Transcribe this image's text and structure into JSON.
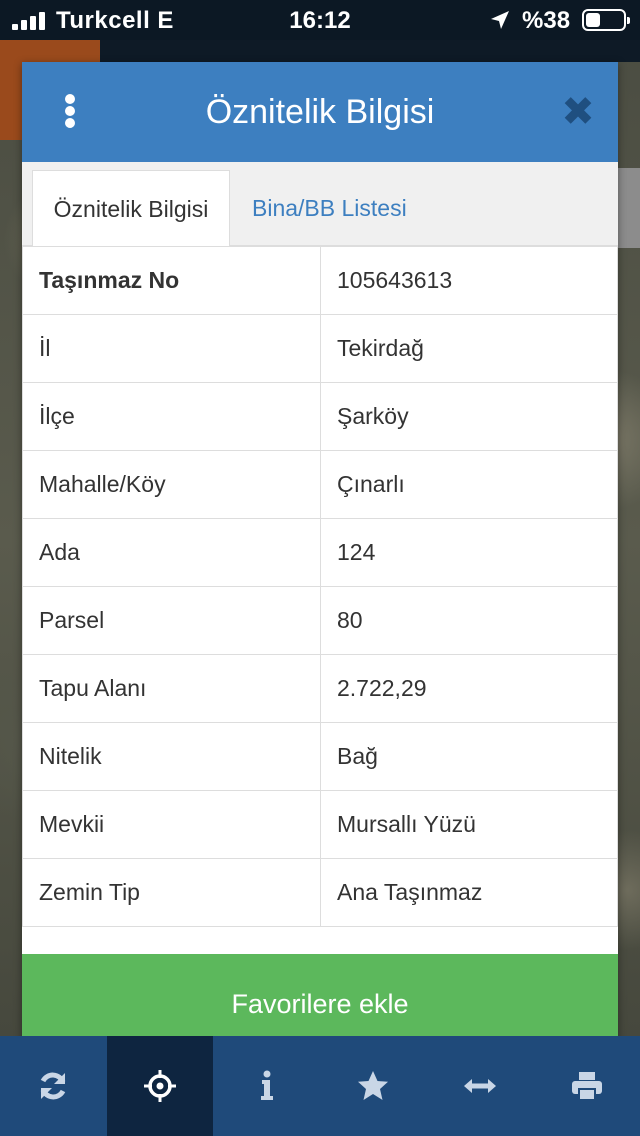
{
  "status_bar": {
    "carrier": "Turkcell  E",
    "time": "16:12",
    "battery": "%38"
  },
  "modal": {
    "title": "Öznitelik Bilgisi",
    "close": "✖",
    "tabs": [
      {
        "label": "Öznitelik Bilgisi",
        "active": true
      },
      {
        "label": "Bina/BB Listesi",
        "active": false
      }
    ],
    "rows": [
      {
        "key": "Taşınmaz No",
        "value": "105643613"
      },
      {
        "key": "İl",
        "value": "Tekirdağ"
      },
      {
        "key": "İlçe",
        "value": "Şarköy"
      },
      {
        "key": "Mahalle/Köy",
        "value": "Çınarlı"
      },
      {
        "key": "Ada",
        "value": "124"
      },
      {
        "key": "Parsel",
        "value": "80"
      },
      {
        "key": "Tapu Alanı",
        "value": "2.722,29"
      },
      {
        "key": "Nitelik",
        "value": "Bağ"
      },
      {
        "key": "Mevkii",
        "value": "Mursallı Yüzü"
      },
      {
        "key": "Zemin Tip",
        "value": "Ana Taşınmaz"
      }
    ],
    "favorite_button": "Favorilere ekle"
  },
  "toolbar": {
    "items": [
      "refresh-icon",
      "locate-icon",
      "info-icon",
      "star-icon",
      "measure-icon",
      "print-icon"
    ],
    "active": "info-icon"
  },
  "colors": {
    "header": "#3d7fc0",
    "favorite": "#5cb85c",
    "toolbar": "#1f4a7a"
  }
}
